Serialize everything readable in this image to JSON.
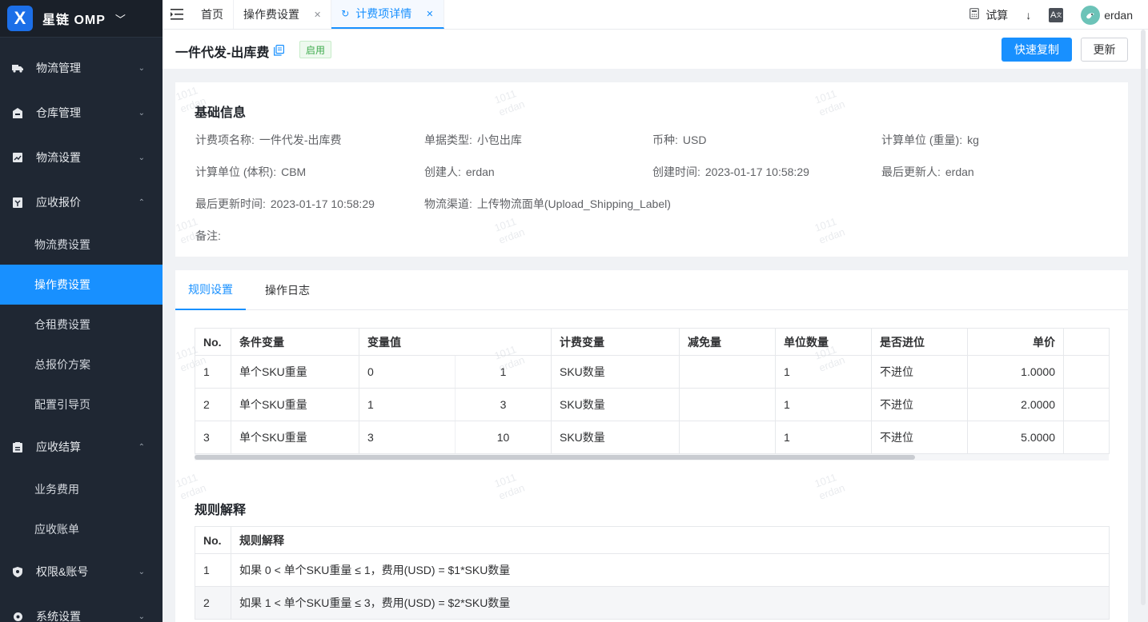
{
  "brand": {
    "name": "星链  OMP",
    "logo_letter": "X"
  },
  "sidebar": {
    "groups": [
      {
        "label": "物流管理",
        "icon": "truck-icon",
        "arrow": "⌄"
      },
      {
        "label": "仓库管理",
        "icon": "warehouse-icon",
        "arrow": "⌄"
      },
      {
        "label": "物流设置",
        "icon": "settings-chart-icon",
        "arrow": "⌄"
      },
      {
        "label": "应收报价",
        "icon": "quote-icon",
        "arrow": "⌃"
      },
      {
        "label": "应收结算",
        "icon": "clipboard-icon",
        "arrow": "⌃"
      },
      {
        "label": "权限&账号",
        "icon": "shield-icon",
        "arrow": "⌄"
      },
      {
        "label": "系统设置",
        "icon": "gear-icon",
        "arrow": "⌄"
      }
    ],
    "quote_items": [
      "物流费设置",
      "操作费设置",
      "仓租费设置",
      "总报价方案",
      "配置引导页"
    ],
    "settle_items": [
      "业务费用",
      "应收账单"
    ]
  },
  "tabs": [
    {
      "label": "首页"
    },
    {
      "label": "操作费设置"
    },
    {
      "label": "计费项详情"
    }
  ],
  "topright": {
    "trial": "试算",
    "user": "erdan"
  },
  "header": {
    "title": "一件代发-出库费",
    "status": "启用",
    "copy_button": "快速复制",
    "update_button": "更新"
  },
  "info": {
    "title": "基础信息",
    "fields": [
      {
        "label": "计费项名称:",
        "value": "一件代发-出库费"
      },
      {
        "label": "单据类型:",
        "value": "小包出库"
      },
      {
        "label": "币种:",
        "value": "USD"
      },
      {
        "label": "计算单位 (重量):",
        "value": "kg"
      },
      {
        "label": "计算单位 (体积):",
        "value": "CBM"
      },
      {
        "label": "创建人:",
        "value": "erdan"
      },
      {
        "label": "创建时间:",
        "value": "2023-01-17 10:58:29"
      },
      {
        "label": "最后更新人:",
        "value": "erdan"
      },
      {
        "label": "最后更新时间:",
        "value": "2023-01-17 10:58:29"
      },
      {
        "label": "物流渠道:",
        "value": "上传物流面单(Upload_Shipping_Label)"
      },
      {
        "label": "备注:",
        "value": ""
      }
    ]
  },
  "rule_tabs": [
    "规则设置",
    "操作日志"
  ],
  "rules_table": {
    "headers": [
      "No.",
      "条件变量",
      "变量值",
      "计费变量",
      "减免量",
      "单位数量",
      "是否进位",
      "单价"
    ],
    "rows": [
      {
        "no": "1",
        "cond": "单个SKU重量",
        "v1": "0",
        "v2": "1",
        "var": "SKU数量",
        "deduct": "",
        "unit": "1",
        "carry": "不进位",
        "price": "1.0000"
      },
      {
        "no": "2",
        "cond": "单个SKU重量",
        "v1": "1",
        "v2": "3",
        "var": "SKU数量",
        "deduct": "",
        "unit": "1",
        "carry": "不进位",
        "price": "2.0000"
      },
      {
        "no": "3",
        "cond": "单个SKU重量",
        "v1": "3",
        "v2": "10",
        "var": "SKU数量",
        "deduct": "",
        "unit": "1",
        "carry": "不进位",
        "price": "5.0000"
      }
    ]
  },
  "explain": {
    "title": "规则解释",
    "headers": [
      "No.",
      "规则解释"
    ],
    "rows": [
      {
        "no": "1",
        "text": "如果 0 < 单个SKU重量 ≤ 1，费用(USD) = $1*SKU数量"
      },
      {
        "no": "2",
        "text": "如果 1 < 单个SKU重量 ≤ 3，费用(USD) = $2*SKU数量"
      }
    ]
  },
  "watermark": {
    "line1": "1011",
    "line2": "erdan"
  }
}
